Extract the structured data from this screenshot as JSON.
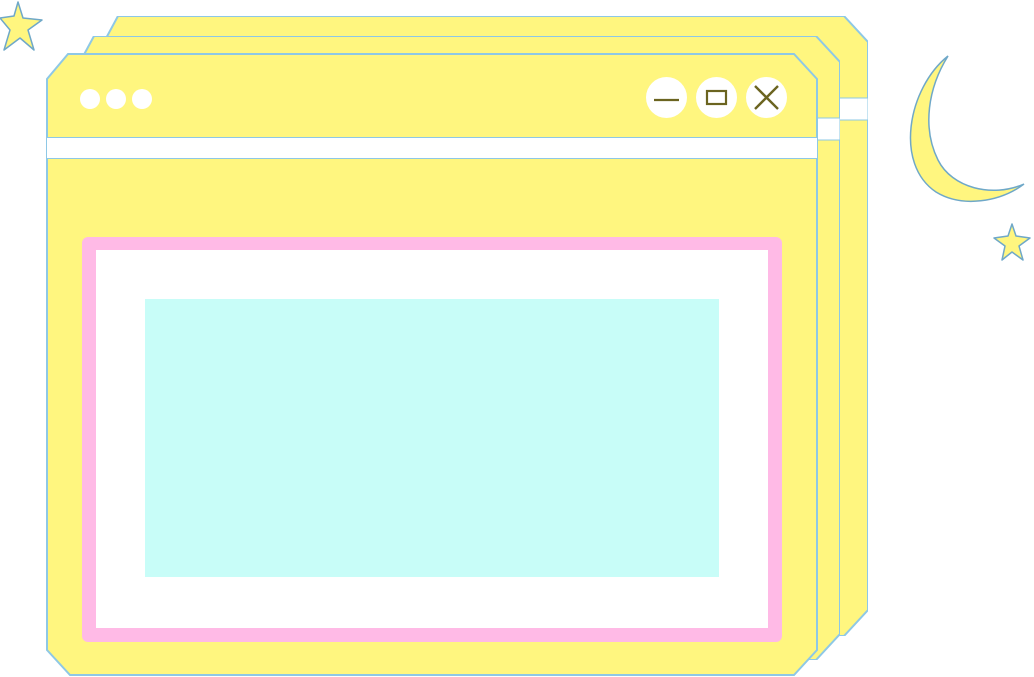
{
  "theme": {
    "window_fill": "#fff67f",
    "window_border": "#8ec8e6",
    "frame_pink": "#ffbae6",
    "content_fill": "#c8fdf8",
    "control_icon_color": "#6b6420"
  },
  "window": {
    "title_dots": [
      "dot",
      "dot",
      "dot"
    ],
    "controls": {
      "minimize_icon": "minimize-icon",
      "maximize_icon": "maximize-icon",
      "close_icon": "close-icon"
    }
  },
  "decorations": {
    "moon_icon": "crescent-moon-icon",
    "star_icon": "star-icon"
  }
}
